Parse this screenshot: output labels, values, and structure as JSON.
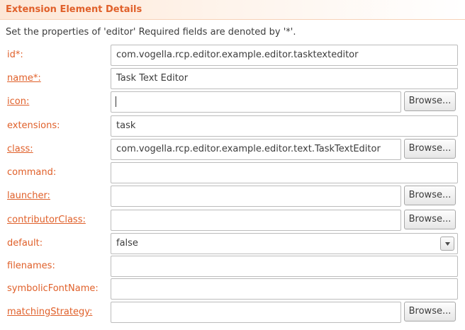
{
  "section": {
    "title": "Extension Element Details",
    "description": "Set the properties of 'editor' Required fields are denoted by '*'."
  },
  "fields": {
    "id": {
      "label": "id*:",
      "value": "com.vogella.rcp.editor.example.editor.tasktexteditor"
    },
    "name": {
      "label": "name*:",
      "value": "Task Text Editor"
    },
    "icon": {
      "label": "icon:",
      "value": ""
    },
    "extensions": {
      "label": "extensions:",
      "value": "task"
    },
    "class": {
      "label": "class:",
      "value": "com.vogella.rcp.editor.example.editor.text.TaskTextEditor"
    },
    "command": {
      "label": "command:",
      "value": ""
    },
    "launcher": {
      "label": "launcher:",
      "value": ""
    },
    "contributorClass": {
      "label": "contributorClass:",
      "value": ""
    },
    "default": {
      "label": "default:",
      "value": "false"
    },
    "filenames": {
      "label": "filenames:",
      "value": ""
    },
    "symbolicFontName": {
      "label": "symbolicFontName:",
      "value": ""
    },
    "matchingStrategy": {
      "label": "matchingStrategy:",
      "value": ""
    }
  },
  "buttons": {
    "browse_label": "Browse..."
  },
  "colors": {
    "label_accent": "#e0602a",
    "header_start": "#fde7d6"
  },
  "icons": {
    "dropdown": "chevron-down-icon"
  }
}
